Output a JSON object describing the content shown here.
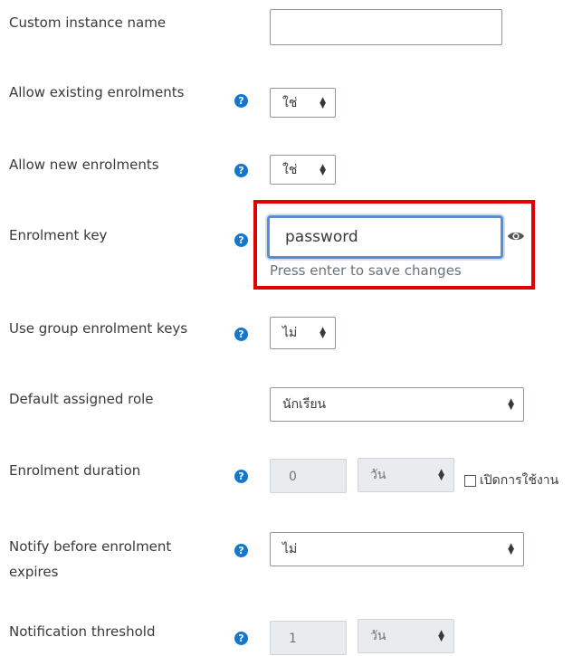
{
  "fields": {
    "custom_name": {
      "label": "Custom instance name",
      "value": ""
    },
    "allow_existing": {
      "label": "Allow existing enrolments",
      "value": "ใช่"
    },
    "allow_new": {
      "label": "Allow new enrolments",
      "value": "ใช่"
    },
    "enrolment_key": {
      "label": "Enrolment key",
      "value": "password",
      "hint": "Press enter to save changes"
    },
    "group_keys": {
      "label": "Use group enrolment keys",
      "value": "ไม่"
    },
    "default_role": {
      "label": "Default assigned role",
      "value": "นักเรียน"
    },
    "duration": {
      "label": "Enrolment duration",
      "number": "0",
      "unit": "วัน",
      "enable_label": "เปิดการใช้งาน"
    },
    "notify": {
      "label_line1": "Notify before enrolment",
      "label_line2": "expires",
      "value": "ไม่"
    },
    "threshold": {
      "label": "Notification threshold",
      "number": "1",
      "unit": "วัน"
    }
  },
  "icons": {
    "help": "question-circle-icon",
    "eye": "eye-icon",
    "select_arrow": "up-down-caret-icon"
  },
  "colors": {
    "help_blue": "#1177d1",
    "highlight_red": "#e00000",
    "focus_blue": "#5a8ed0"
  }
}
